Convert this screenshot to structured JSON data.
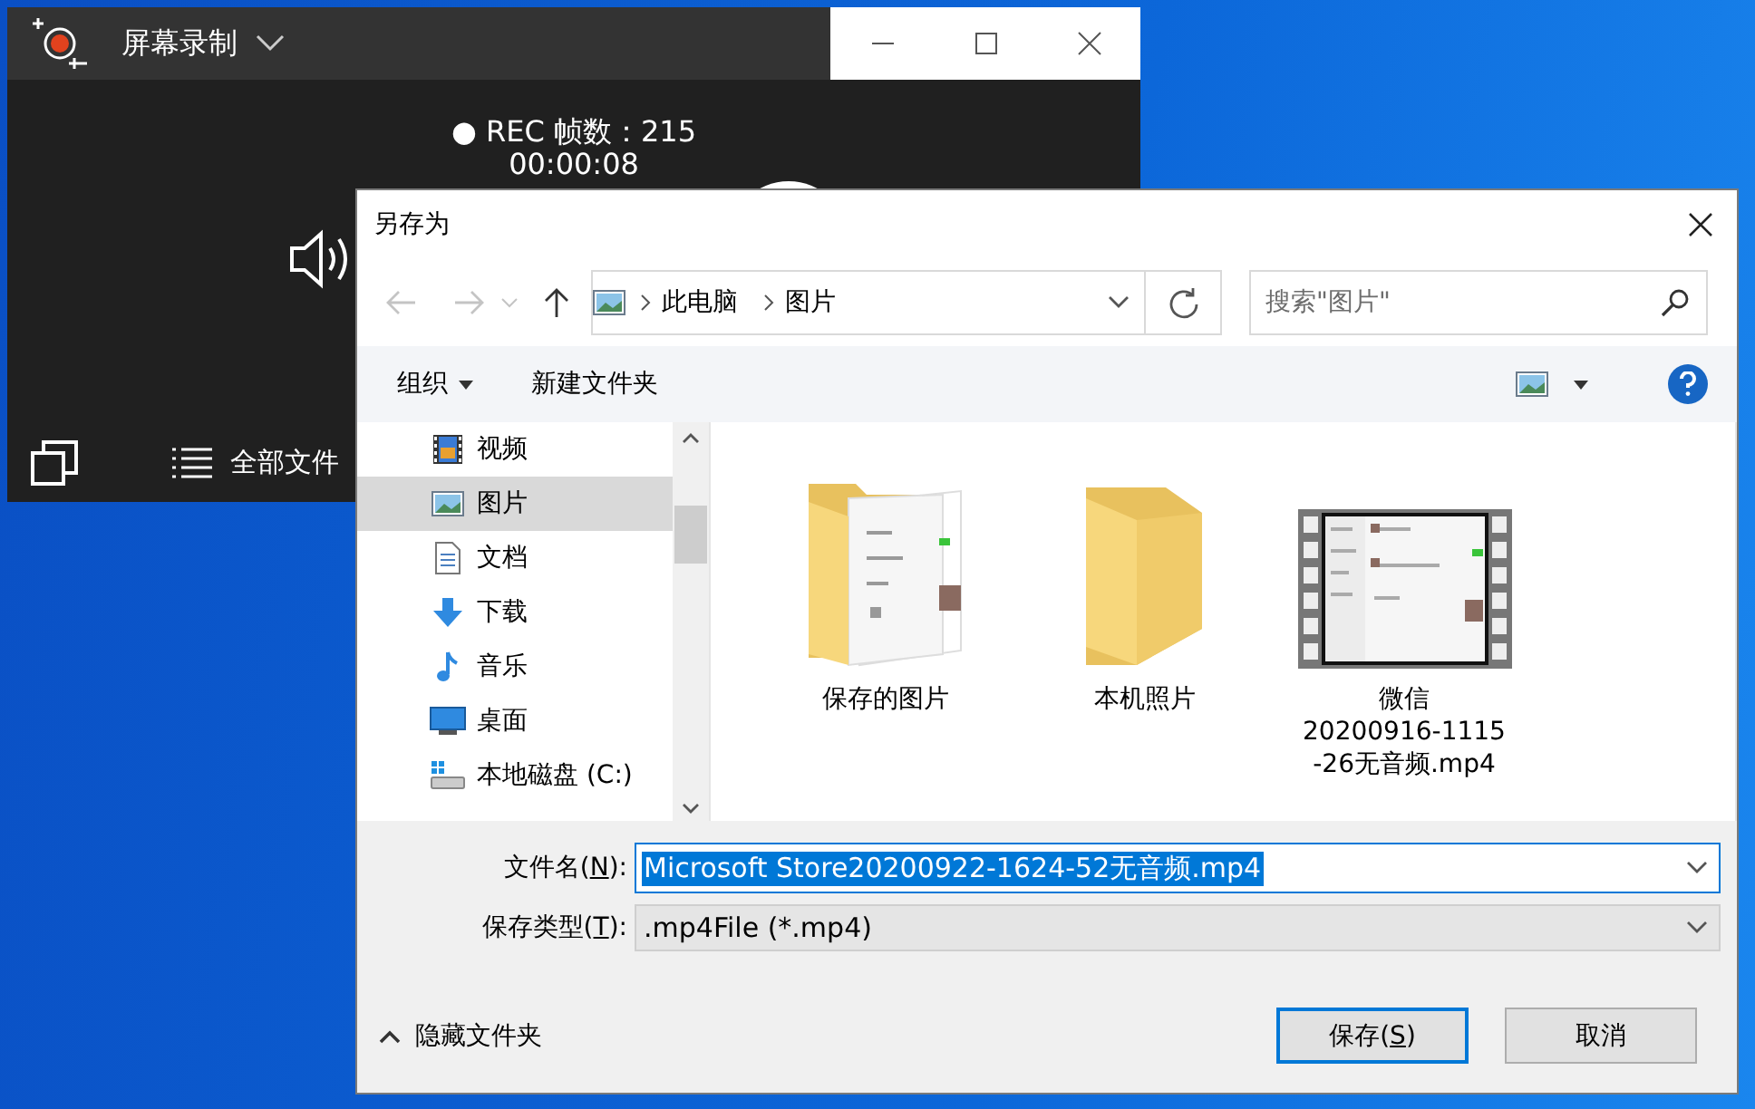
{
  "recorder": {
    "title": "屏幕录制",
    "status": "● REC 帧数：215",
    "elapsed": "00:00:08",
    "files_button": "全部文件"
  },
  "dialog": {
    "title": "另存为",
    "breadcrumb": [
      "此电脑",
      "图片"
    ],
    "search": {
      "placeholder": "搜索\"图片\""
    },
    "toolbar": {
      "organize": "组织",
      "new_folder": "新建文件夹"
    },
    "nav_items": [
      {
        "label": "视频",
        "kind": "video",
        "selected": false
      },
      {
        "label": "图片",
        "kind": "picture",
        "selected": true
      },
      {
        "label": "文档",
        "kind": "document",
        "selected": false
      },
      {
        "label": "下载",
        "kind": "download",
        "selected": false
      },
      {
        "label": "音乐",
        "kind": "music",
        "selected": false
      },
      {
        "label": "桌面",
        "kind": "desktop",
        "selected": false
      },
      {
        "label": "本地磁盘 (C:)",
        "kind": "drive",
        "selected": false
      }
    ],
    "files": [
      {
        "kind": "folder_with_content",
        "name_lines": [
          "保存的图片"
        ]
      },
      {
        "kind": "folder",
        "name_lines": [
          "本机照片"
        ]
      },
      {
        "kind": "video",
        "name_lines": [
          "微信",
          "20200916-1115",
          "-26无音频.mp4"
        ]
      }
    ],
    "filename": {
      "label_parts": [
        "文件名(",
        "N",
        "):"
      ],
      "value": "Microsoft Store20200922-1624-52无音频.mp4",
      "text_selected": true
    },
    "filetype": {
      "label_parts": [
        "保存类型(",
        "T",
        "):"
      ],
      "value": ".mp4File (*.mp4)"
    },
    "hide_folders": "隐藏文件夹",
    "buttons": [
      {
        "label_parts": [
          "保存(",
          "S",
          ")"
        ],
        "default": true
      },
      {
        "label_parts": [
          "取消"
        ],
        "default": false
      }
    ]
  }
}
